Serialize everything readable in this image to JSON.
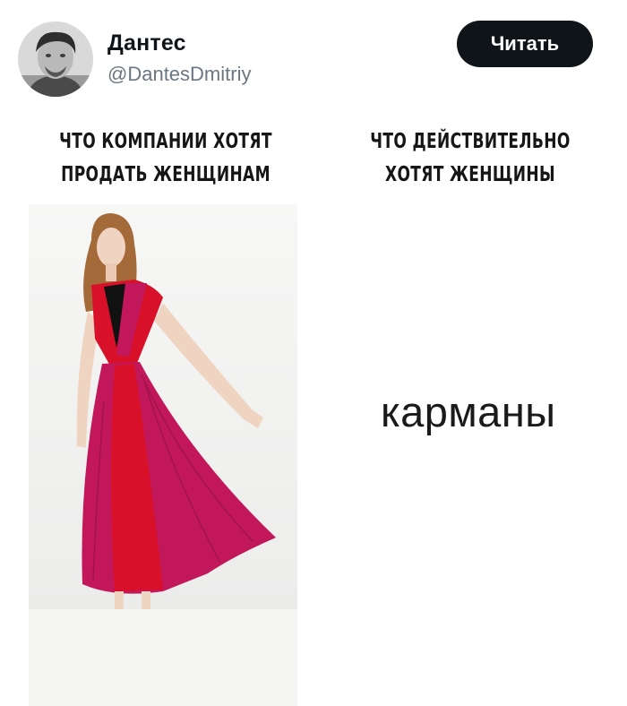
{
  "post": {
    "author_name": "Дантес",
    "author_handle": "@DantesDmitriy",
    "follow_label": "Читать"
  },
  "meme": {
    "left_caption": [
      "ЧТО КОМПАНИИ ХОТЯТ",
      "ПРОДАТЬ ЖЕНЩИНАМ"
    ],
    "right_caption": [
      "ЧТО ДЕЙСТВИТЕЛЬНО",
      "ХОТЯТ ЖЕНЩИНЫ"
    ],
    "answer_text": "карманы"
  },
  "colors": {
    "button_bg": "#0f1419",
    "handle": "#6b7680",
    "dress_red": "#d8102a",
    "dress_pink": "#c2185b"
  }
}
